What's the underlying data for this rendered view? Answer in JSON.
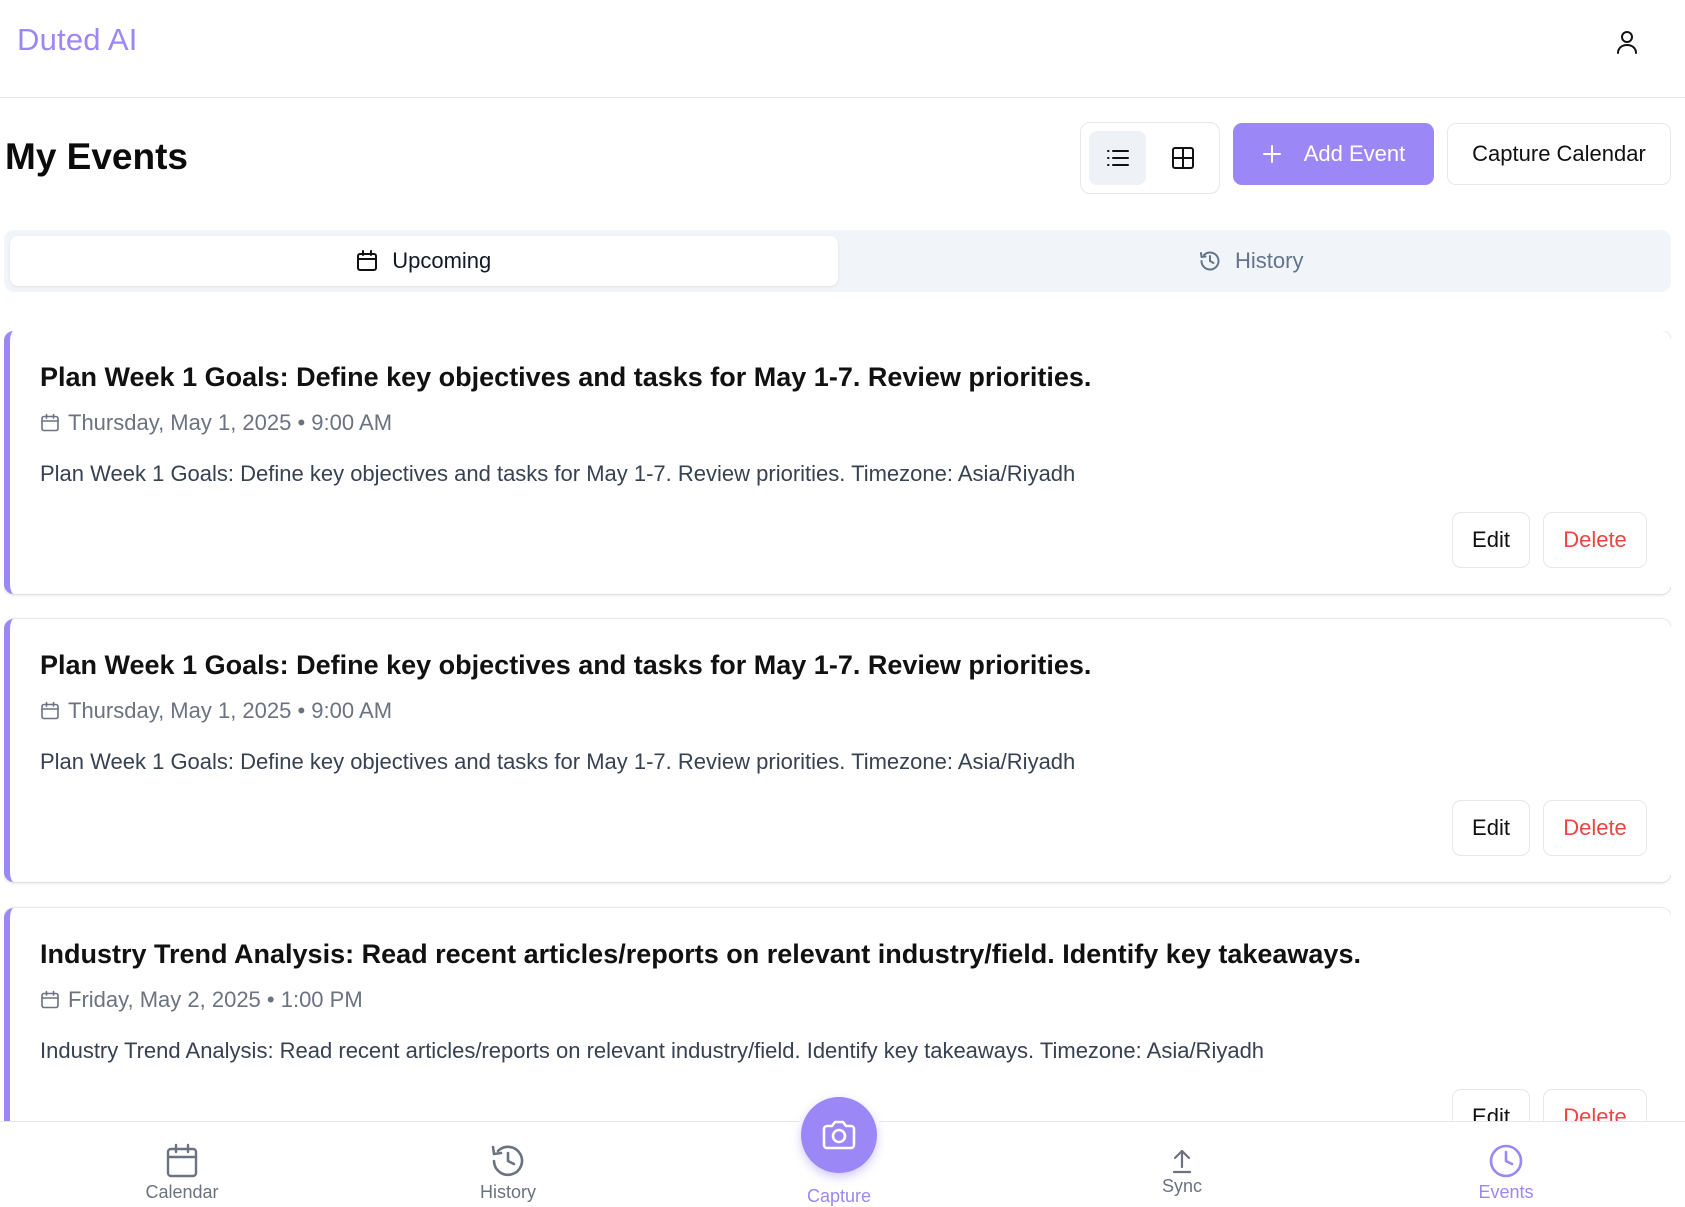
{
  "app": {
    "brand": "Duted AI"
  },
  "header": {
    "title": "My Events"
  },
  "toolbar": {
    "add_label": "Add Event",
    "capture_calendar_label": "Capture Calendar",
    "view_mode": "list"
  },
  "tabs": [
    {
      "label": "Upcoming",
      "icon": "calendar-icon",
      "active": true
    },
    {
      "label": "History",
      "icon": "history-icon",
      "active": false
    }
  ],
  "events": [
    {
      "title": "Plan Week 1 Goals: Define key objectives and tasks for May 1-7. Review priorities.",
      "date": "Thursday, May 1, 2025 • 9:00 AM",
      "description": "Plan Week 1 Goals: Define key objectives and tasks for May 1-7. Review priorities. Timezone: Asia/Riyadh",
      "edit_label": "Edit",
      "delete_label": "Delete"
    },
    {
      "title": "Plan Week 1 Goals: Define key objectives and tasks for May 1-7. Review priorities.",
      "date": "Thursday, May 1, 2025 • 9:00 AM",
      "description": "Plan Week 1 Goals: Define key objectives and tasks for May 1-7. Review priorities. Timezone: Asia/Riyadh",
      "edit_label": "Edit",
      "delete_label": "Delete"
    },
    {
      "title": "Industry Trend Analysis: Read recent articles/reports on relevant industry/field. Identify key takeaways.",
      "date": "Friday, May 2, 2025 • 1:00 PM",
      "description": "Industry Trend Analysis: Read recent articles/reports on relevant industry/field. Identify key takeaways. Timezone: Asia/Riyadh",
      "edit_label": "Edit",
      "delete_label": "Delete"
    }
  ],
  "bottom_nav": {
    "calendar": "Calendar",
    "history": "History",
    "capture": "Capture",
    "sync": "Sync",
    "events": "Events",
    "active": "events"
  },
  "colors": {
    "accent": "#9b87f5",
    "danger": "#ef4444",
    "muted": "#6b7280",
    "tab_bg": "#f1f4f8"
  }
}
